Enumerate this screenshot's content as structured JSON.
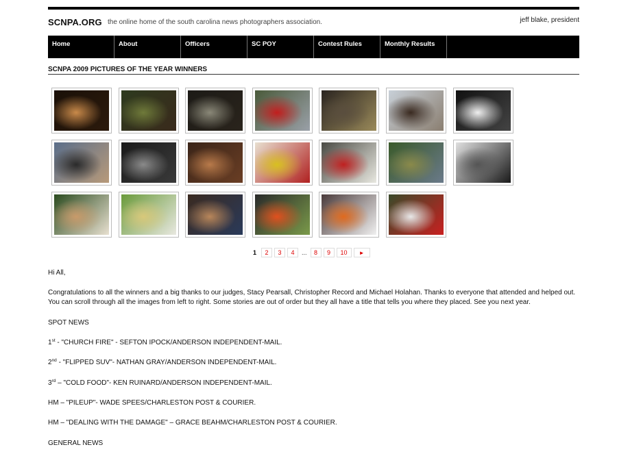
{
  "header": {
    "site_name": "SCNPA.ORG",
    "tagline": "the online home of the south carolina news photographers association.",
    "president": "jeff blake, president"
  },
  "nav": {
    "items": [
      {
        "label": "Home"
      },
      {
        "label": "About"
      },
      {
        "label": "Officers"
      },
      {
        "label": "SC POY"
      },
      {
        "label": "Contest Rules"
      },
      {
        "label": "Monthly Results"
      }
    ]
  },
  "page": {
    "title": "SCNPA 2009 PICTURES OF THE YEAR WINNERS"
  },
  "gallery": {
    "thumbnails": [
      {
        "subject": "embrace at night fire",
        "palette": [
          "#1a1008",
          "#c98a4a",
          "#2c1a0c"
        ]
      },
      {
        "subject": "overhead cluttered scene",
        "palette": [
          "#2d3a1e",
          "#6f7a3a",
          "#3a2a1c"
        ]
      },
      {
        "subject": "burned interior with refrigerator",
        "palette": [
          "#1c1a16",
          "#8a8878",
          "#2a241c"
        ]
      },
      {
        "subject": "car pileup",
        "palette": [
          "#4a5a3a",
          "#c21e1e",
          "#9aa0a8"
        ]
      },
      {
        "subject": "damaged building",
        "palette": [
          "#2a2420",
          "#5a4e3e",
          "#9a8a5a"
        ]
      },
      {
        "subject": "child by tree in debris",
        "palette": [
          "#c8d0d8",
          "#3a2a20",
          "#8a7e70"
        ]
      },
      {
        "subject": "man with protest sign",
        "palette": [
          "#111111",
          "#f0f0f0",
          "#444444"
        ]
      },
      {
        "subject": "celebrating man outside",
        "palette": [
          "#5a6e8a",
          "#2a2a2a",
          "#b89a7a"
        ]
      },
      {
        "subject": "two men embracing bw",
        "palette": [
          "#1a1a1a",
          "#8a8a8a",
          "#3a3a3a"
        ]
      },
      {
        "subject": "crowd in restaurant",
        "palette": [
          "#3a2418",
          "#b87a4a",
          "#6a3e24"
        ]
      },
      {
        "subject": "couple under flag",
        "palette": [
          "#e8e0d0",
          "#d8c020",
          "#b02020"
        ]
      },
      {
        "subject": "truck with boy",
        "palette": [
          "#4a4a44",
          "#c02020",
          "#e8e8e0"
        ]
      },
      {
        "subject": "children running field",
        "palette": [
          "#3a5a2a",
          "#8a8a4a",
          "#6a7a8a"
        ]
      },
      {
        "subject": "jumping into water bw",
        "palette": [
          "#e0e0e0",
          "#555555",
          "#1a1a1a"
        ]
      },
      {
        "subject": "child on shoulders",
        "palette": [
          "#2a4a1e",
          "#c89a6a",
          "#e8e0d0"
        ]
      },
      {
        "subject": "football helmet tackle",
        "palette": [
          "#6a9a3a",
          "#d8c87a",
          "#e8e8e0"
        ]
      },
      {
        "subject": "wrestlers",
        "palette": [
          "#3a2a20",
          "#b8865a",
          "#2a3a5a"
        ]
      },
      {
        "subject": "football player end zone",
        "palette": [
          "#2a2a2a",
          "#e0501e",
          "#7a9a4a"
        ]
      },
      {
        "subject": "football players orange",
        "palette": [
          "#4a3a3a",
          "#e06a1e",
          "#f0f0f0"
        ]
      },
      {
        "subject": "diving baseball player",
        "palette": [
          "#3a4a2a",
          "#e8e8e8",
          "#c82020"
        ]
      }
    ]
  },
  "pager": {
    "current": "1",
    "pages": [
      "2",
      "3",
      "4"
    ],
    "ellipsis": "...",
    "pages_end": [
      "8",
      "9",
      "10"
    ],
    "next_symbol": "►"
  },
  "article": {
    "greeting": "Hi All,",
    "intro": "Congratulations to all the winners and a big thanks to our judges, Stacy Pearsall, Christopher Record and Michael Holahan. Thanks to everyone that attended and helped out. You can scroll through all the images from left to right. Some stories are out of order but they all have a title that tells you where they placed. See you next year.",
    "sections": [
      {
        "heading": "SPOT NEWS",
        "entries": [
          {
            "place": "1",
            "suffix": "st",
            "text": " - \"CHURCH FIRE\" - SEFTON IPOCK/ANDERSON INDEPENDENT-MAIL."
          },
          {
            "place": "2",
            "suffix": "nd",
            "text": " - \"FLIPPED SUV\"- NATHAN GRAY/ANDERSON INDEPENDENT-MAIL."
          },
          {
            "place": "3",
            "suffix": "rd",
            "text": " – \"COLD FOOD\"- KEN RUINARD/ANDERSON INDEPENDENT-MAIL."
          },
          {
            "place": "HM",
            "suffix": "",
            "text": " – \"PILEUP\"- WADE SPEES/CHARLESTON POST & COURIER."
          },
          {
            "place": "HM",
            "suffix": "",
            "text": " – \"DEALING WITH THE DAMAGE\" – GRACE BEAHM/CHARLESTON POST & COURIER."
          }
        ]
      },
      {
        "heading": "GENERAL NEWS",
        "entries": []
      }
    ]
  }
}
